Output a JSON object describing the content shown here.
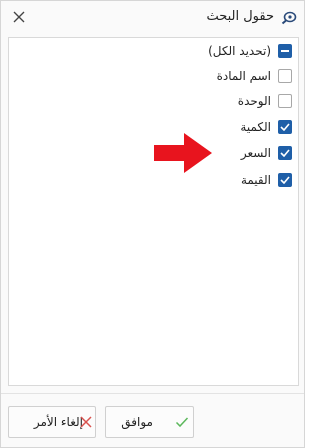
{
  "dialog": {
    "title": "حقول البحث",
    "title_icon": "search-settings-icon",
    "close_icon": "close-icon"
  },
  "fields": [
    {
      "label": "(تحديد الكل)",
      "state": "partial"
    },
    {
      "label": "اسم المادة",
      "state": "unchecked"
    },
    {
      "label": "الوحدة",
      "state": "unchecked"
    },
    {
      "label": "الكمية",
      "state": "checked"
    },
    {
      "label": "السعر",
      "state": "checked"
    },
    {
      "label": "القيمة",
      "state": "checked"
    }
  ],
  "annotation": {
    "arrow_icon": "red-arrow-icon",
    "color": "#e8141e",
    "points_to": "السعر"
  },
  "buttons": {
    "ok_label": "موافق",
    "ok_icon": "check-icon",
    "cancel_label": "إلغاء الأمر",
    "cancel_icon": "x-icon"
  },
  "colors": {
    "checkbox_accent": "#1f5fa8",
    "ok_icon": "#5cb85c",
    "cancel_icon": "#d9534f"
  }
}
